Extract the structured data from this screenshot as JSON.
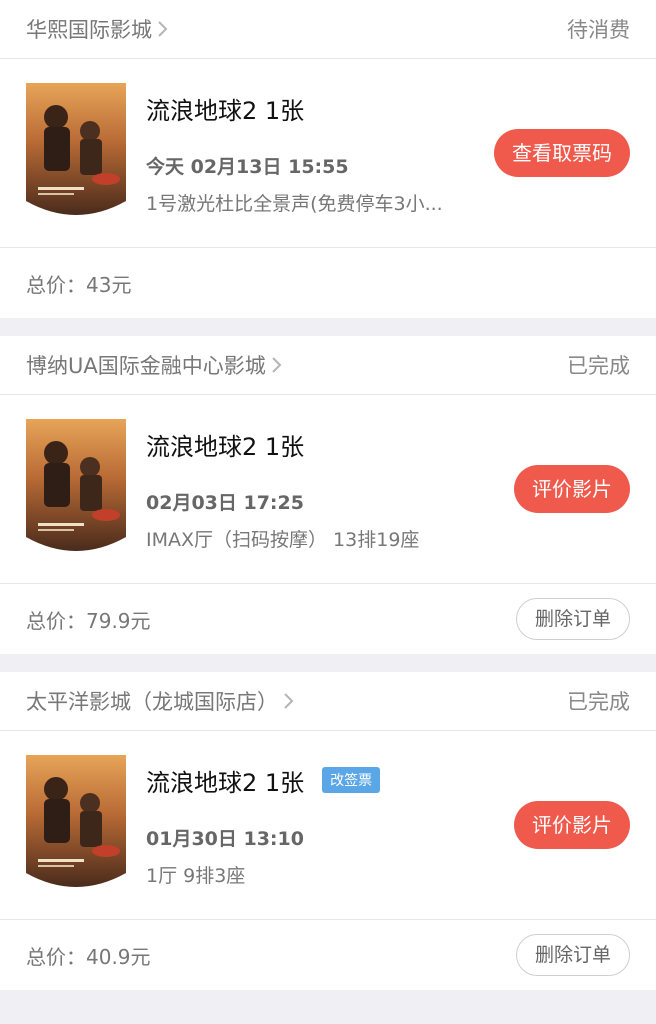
{
  "orders": [
    {
      "cinema": "华熙国际影城",
      "status": "待消费",
      "title": "流浪地球2 1张",
      "badge": "",
      "showtime": "今天 02月13日 15:55",
      "hall": "1号激光杜比全景声(免费停车3小...",
      "action": "查看取票码",
      "total_label": "总价：",
      "total_value": "43元",
      "delete": ""
    },
    {
      "cinema": "博纳UA国际金融中心影城",
      "status": "已完成",
      "title": "流浪地球2 1张",
      "badge": "",
      "showtime": "02月03日 17:25",
      "hall": "IMAX厅（扫码按摩） 13排19座",
      "action": "评价影片",
      "total_label": "总价：",
      "total_value": "79.9元",
      "delete": "删除订单"
    },
    {
      "cinema": "太平洋影城（龙城国际店）",
      "status": "已完成",
      "title": "流浪地球2 1张",
      "badge": "改签票",
      "showtime": "01月30日 13:10",
      "hall": "1厅 9排3座",
      "action": "评价影片",
      "total_label": "总价：",
      "total_value": "40.9元",
      "delete": "删除订单"
    }
  ],
  "colors": {
    "accent": "#ef5a4c",
    "badge": "#5aa6e6",
    "page_bg": "#efeff4"
  },
  "icons": {
    "chevron": "chevron-right-icon",
    "poster": "movie-poster"
  }
}
